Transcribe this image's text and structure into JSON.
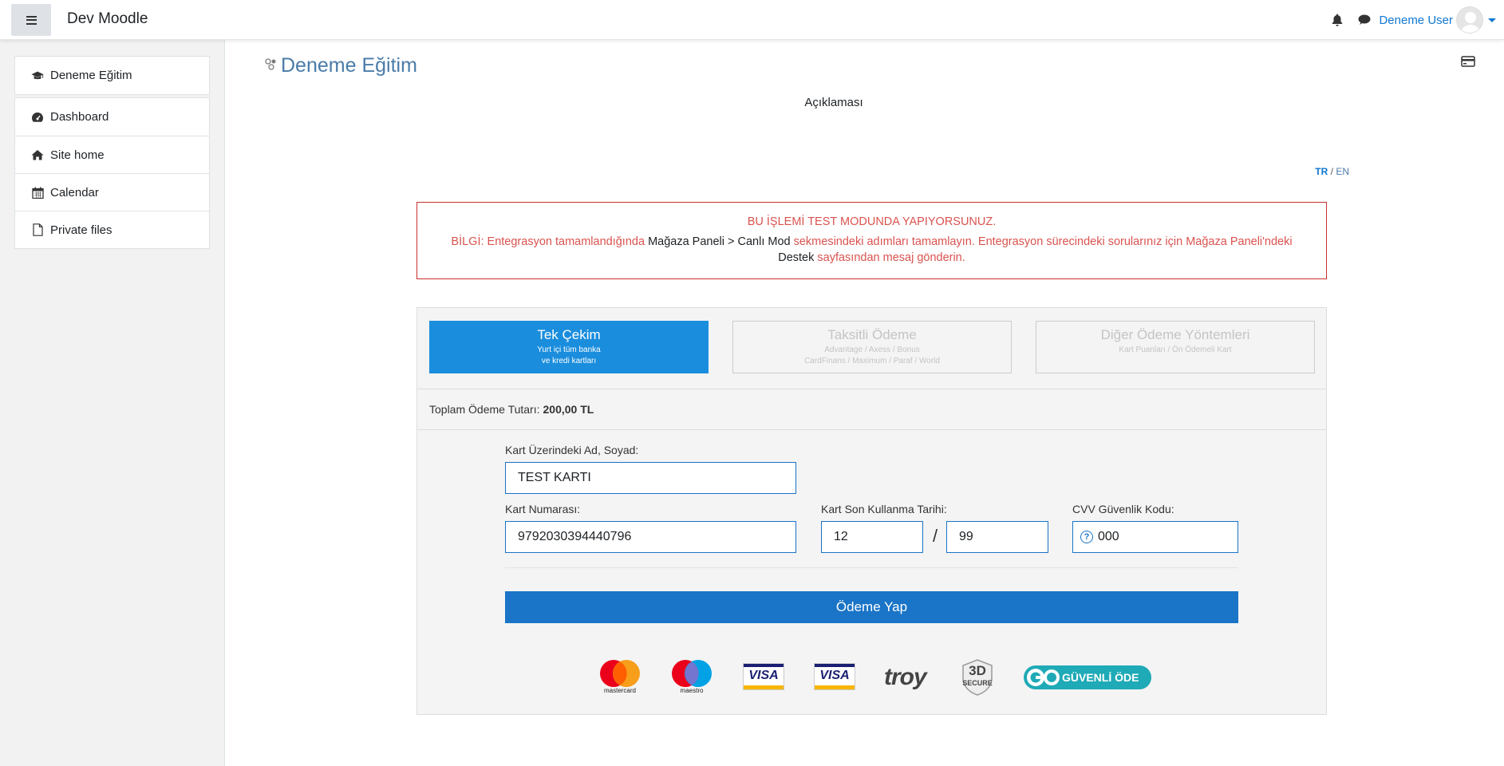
{
  "navbar": {
    "brand": "Dev Moodle",
    "username": "Deneme User"
  },
  "drawer": {
    "course": "Deneme Eğitim",
    "items": [
      {
        "label": "Dashboard",
        "icon": "dashboard-icon"
      },
      {
        "label": "Site home",
        "icon": "home-icon"
      },
      {
        "label": "Calendar",
        "icon": "calendar-icon"
      },
      {
        "label": "Private files",
        "icon": "file-icon"
      }
    ]
  },
  "page": {
    "title": "Deneme Eğitim",
    "description": "Açıklaması",
    "lang_tr": "TR",
    "lang_sep": "/",
    "lang_en": "EN"
  },
  "alert": {
    "line1": "BU İŞLEMİ TEST MODUNDA YAPIYORSUNUZ.",
    "p1": "BİLGİ: Entegrasyon tamamlandığında ",
    "p2": "Mağaza Paneli > Canlı Mod",
    "p3": " sekmesindeki adımları tamamlayın. Entegrasyon sürecindeki sorularınız için Mağaza Paneli'ndeki",
    "p4": "Destek",
    "p5": " sayfasından mesaj gönderin."
  },
  "payment": {
    "tabs": [
      {
        "title": "Tek Çekim",
        "sub1": "Yurt içi tüm banka",
        "sub2": "ve kredi kartları"
      },
      {
        "title": "Taksitli Ödeme",
        "sub1": "Advantage / Axess / Bonus",
        "sub2": "CardFinans / Maximum / Paraf / World"
      },
      {
        "title": "Diğer Ödeme Yöntemleri",
        "sub1": "Kart Puanları / Ön Ödemeli Kart",
        "sub2": ""
      }
    ],
    "total_label": "Toplam Ödeme Tutarı:",
    "total_value": "200,00 TL",
    "name_label": "Kart Üzerindeki Ad, Soyad:",
    "name_value": "TEST KARTI",
    "number_label": "Kart Numarası:",
    "number_value": "9792030394440796",
    "expiry_label": "Kart Son Kullanma Tarihi:",
    "expiry_month": "12",
    "expiry_sep": "/",
    "expiry_year": "99",
    "cvv_label": "CVV Güvenlik Kodu:",
    "cvv_value": "000",
    "submit": "Ödeme Yap"
  },
  "logos": {
    "mastercard": "mastercard",
    "maestro": "maestro",
    "visa1": "VISA",
    "visa2": "VISA",
    "troy": "troy",
    "secure_3d": "3D",
    "secure_word": "SECURE",
    "guvenli": "GÜVENLİ ÖDE"
  },
  "colors": {
    "accent": "#1a74c7",
    "active_tab": "#1a8ddd",
    "alert_red": "#d9534f",
    "title_blue": "#4a7ba8"
  }
}
